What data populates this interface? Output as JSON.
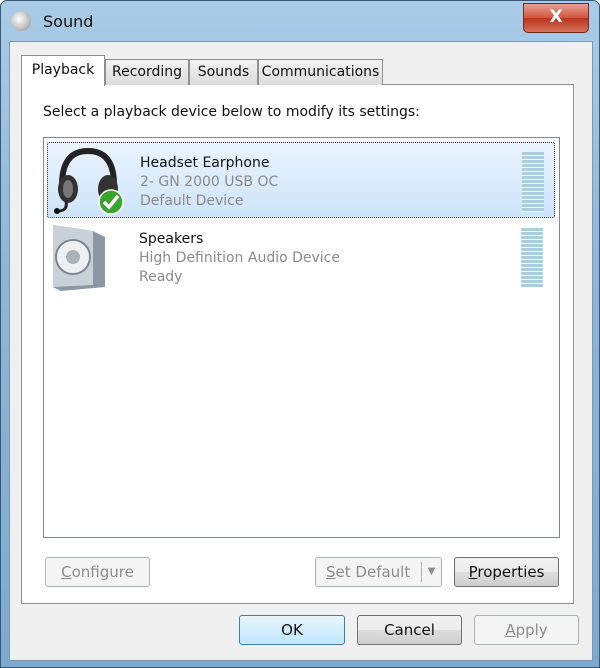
{
  "window": {
    "title": "Sound",
    "close_label": "X"
  },
  "tabs": [
    {
      "label": "Playback",
      "active": true
    },
    {
      "label": "Recording"
    },
    {
      "label": "Sounds"
    },
    {
      "label": "Communications"
    }
  ],
  "instruction": "Select a playback device below to modify its settings:",
  "devices": [
    {
      "name": "Headset Earphone",
      "description": "2- GN 2000 USB OC",
      "status": "Default Device",
      "icon": "headset-icon",
      "badge": "green-check-icon",
      "selected": true
    },
    {
      "name": "Speakers",
      "description": "High Definition Audio Device",
      "status": "Ready",
      "icon": "speaker-icon"
    }
  ],
  "buttons": {
    "configure": "Configure",
    "set_default": "Set Default",
    "properties": "Properties",
    "ok": "OK",
    "cancel": "Cancel",
    "apply": "Apply"
  }
}
